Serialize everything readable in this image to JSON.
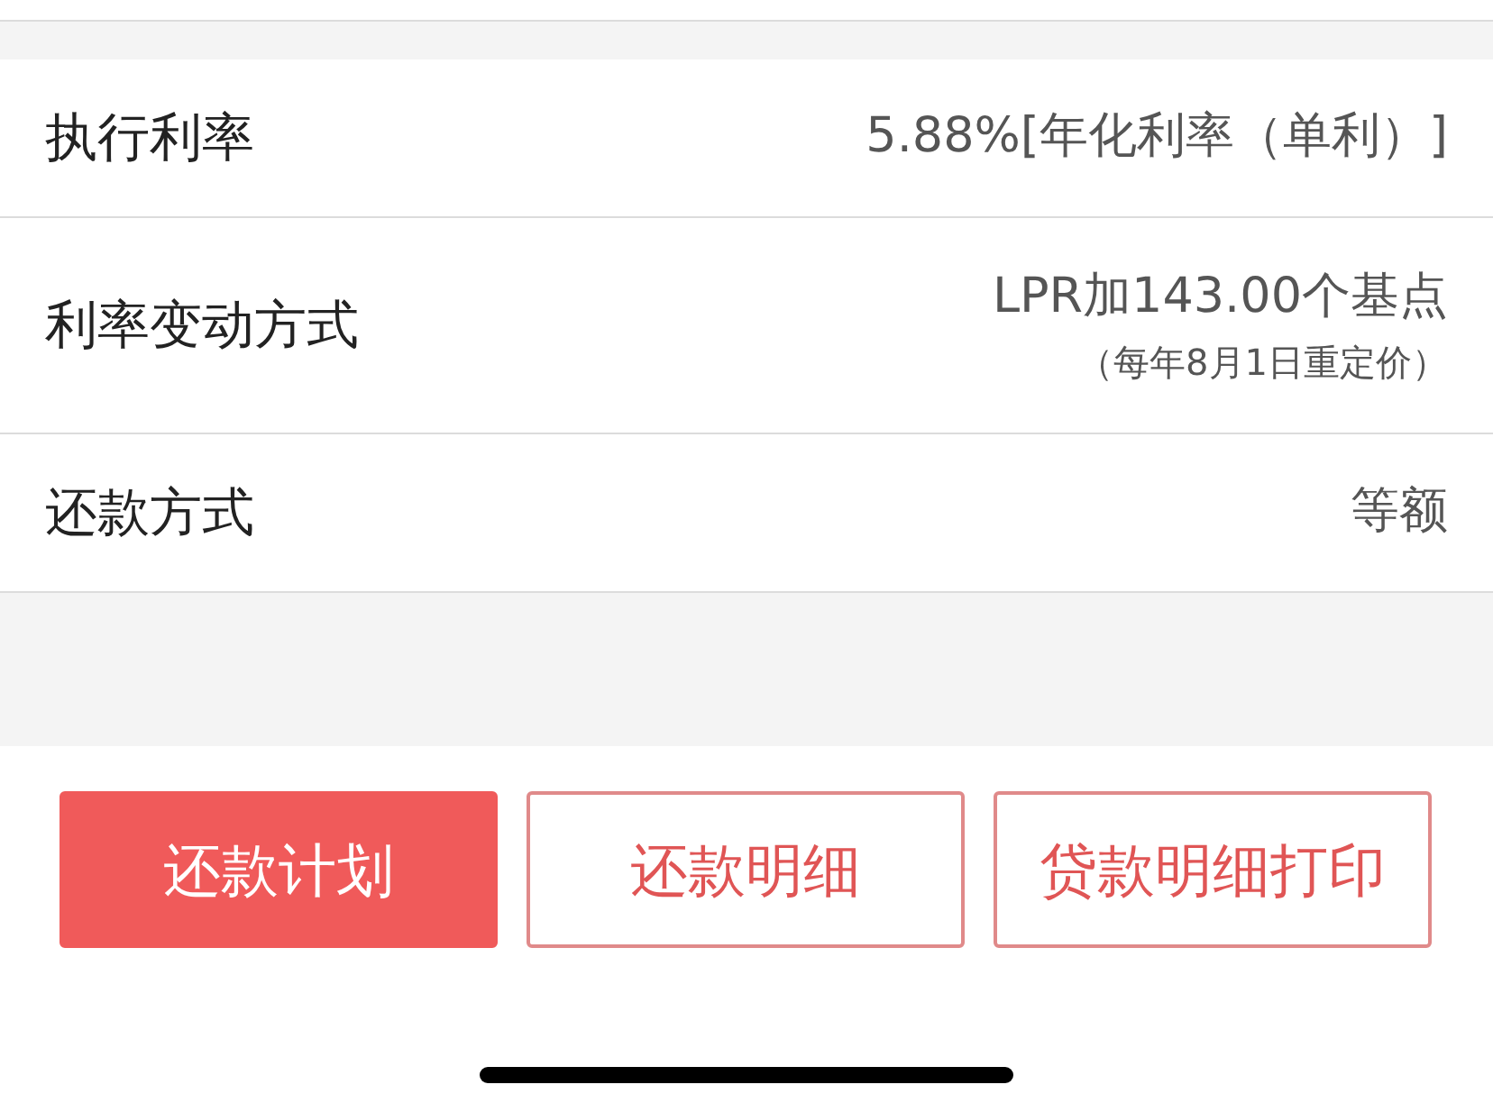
{
  "rows": [
    {
      "label": "执行利率",
      "value": "5.88%[年化利率（单利）]"
    },
    {
      "label": "利率变动方式",
      "value": "LPR加143.00个基点",
      "note": "（每年8月1日重定价）"
    },
    {
      "label": "还款方式",
      "value": "等额"
    }
  ],
  "buttons": [
    {
      "label": "还款计划",
      "kind": "primary"
    },
    {
      "label": "还款明细",
      "kind": "outline"
    },
    {
      "label": "贷款明细打印",
      "kind": "outline"
    }
  ]
}
